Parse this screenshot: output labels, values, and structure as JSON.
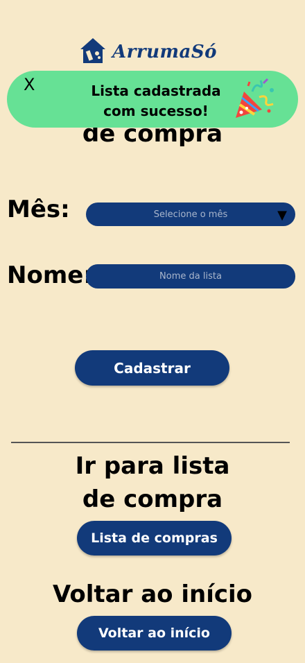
{
  "app": {
    "name": "ArrumaSó"
  },
  "toast": {
    "close_label": "X",
    "line1": "Lista cadastrada",
    "line2": "com sucesso!"
  },
  "page": {
    "title_visible": "de compra"
  },
  "form": {
    "month_label": "Mês:",
    "month_select_placeholder": "Selecione o mês",
    "month_arrow": "▼",
    "name_label": "Nome:",
    "name_placeholder": "Nome da lista",
    "submit_label": "Cadastrar"
  },
  "sections": {
    "go_to_list_line1": "Ir para lista",
    "go_to_list_line2": "de compra",
    "shopping_list_button": "Lista de compras",
    "back_title": "Voltar ao início",
    "back_button": "Voltar ao início"
  },
  "colors": {
    "background": "#f7e9c9",
    "primary": "#123a7a",
    "toast": "#66e195"
  }
}
